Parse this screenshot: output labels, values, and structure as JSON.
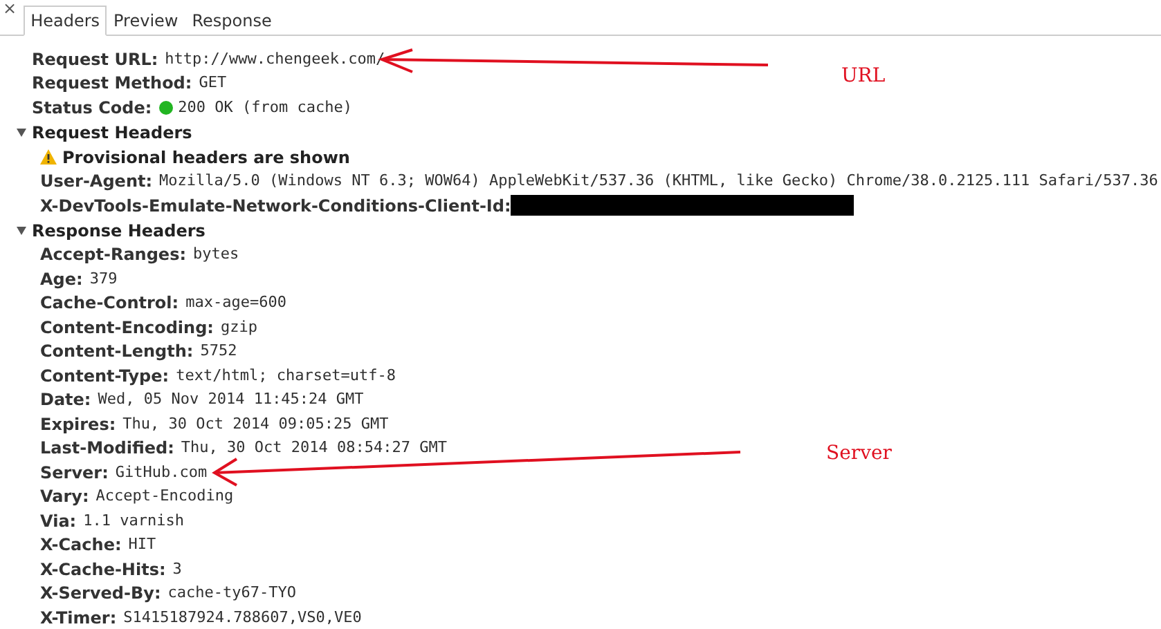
{
  "close_icon": "×",
  "tabs": [
    {
      "label": "Headers",
      "selected": true
    },
    {
      "label": "Preview",
      "selected": false
    },
    {
      "label": "Response",
      "selected": false
    }
  ],
  "general": [
    {
      "name": "Request URL:",
      "value": "http://www.chengeek.com/"
    },
    {
      "name": "Request Method:",
      "value": "GET"
    },
    {
      "name": "Status Code:",
      "value": "200 OK (from cache)",
      "color": "#22b522"
    }
  ],
  "sections": [
    {
      "title": "Request Headers",
      "expanded": true,
      "notice": "Provisional headers are shown",
      "headers": [
        {
          "name": "User-Agent:",
          "value": "Mozilla/5.0 (Windows NT 6.3; WOW64) AppleWebKit/537.36 (KHTML, like Gecko) Chrome/38.0.2125.111 Safari/537.36"
        },
        {
          "name": "X-DevTools-Emulate-Network-Conditions-Client-Id:",
          "redacted": true
        }
      ]
    },
    {
      "title": "Response Headers",
      "expanded": true,
      "headers": [
        {
          "name": "Accept-Ranges:",
          "value": "bytes"
        },
        {
          "name": "Age:",
          "value": "379"
        },
        {
          "name": "Cache-Control:",
          "value": "max-age=600"
        },
        {
          "name": "Content-Encoding:",
          "value": "gzip"
        },
        {
          "name": "Content-Length:",
          "value": "5752"
        },
        {
          "name": "Content-Type:",
          "value": "text/html; charset=utf-8"
        },
        {
          "name": "Date:",
          "value": "Wed, 05 Nov 2014 11:45:24 GMT"
        },
        {
          "name": "Expires:",
          "value": "Thu, 30 Oct 2014 09:05:25 GMT"
        },
        {
          "name": "Last-Modified:",
          "value": "Thu, 30 Oct 2014 08:54:27 GMT"
        },
        {
          "name": "Server:",
          "value": "GitHub.com"
        },
        {
          "name": "Vary:",
          "value": "Accept-Encoding"
        },
        {
          "name": "Via:",
          "value": "1.1 varnish"
        },
        {
          "name": "X-Cache:",
          "value": "HIT"
        },
        {
          "name": "X-Cache-Hits:",
          "value": "3"
        },
        {
          "name": "X-Served-By:",
          "value": "cache-ty67-TYO"
        },
        {
          "name": "X-Timer:",
          "value": "S1415187924.788607,VS0,VE0"
        }
      ]
    }
  ],
  "annotations": [
    {
      "label": "URL"
    },
    {
      "label": "Server"
    }
  ]
}
